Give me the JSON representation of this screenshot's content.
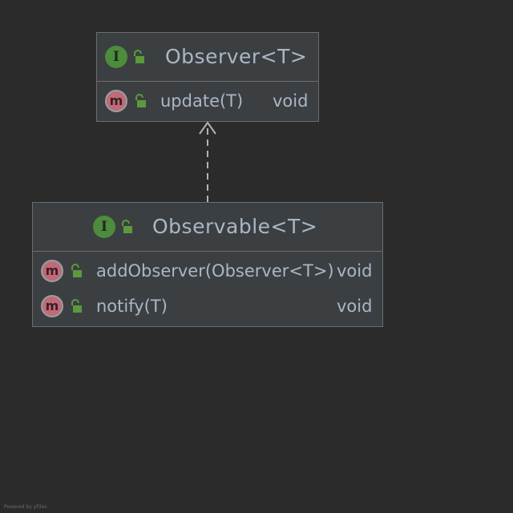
{
  "diagram": {
    "classes": [
      {
        "id": "observer",
        "title": "Observer<T>",
        "kind_letter": "I",
        "kind": "interface",
        "members": [
          {
            "name": "update(T)",
            "type": "void"
          }
        ]
      },
      {
        "id": "observable",
        "title": "Observable<T>",
        "kind_letter": "I",
        "kind": "interface",
        "members": [
          {
            "name": "addObserver(Observer<T>)",
            "type": "void"
          },
          {
            "name": "notify(T)",
            "type": "void"
          }
        ]
      }
    ],
    "edges": [
      {
        "from": "observable",
        "to": "observer",
        "style": "dashed",
        "arrowhead": "open"
      }
    ],
    "method_icon_letter": "m",
    "footer_text": "Powered by yFiles"
  },
  "colors": {
    "background": "#2b2b2b",
    "box_fill": "#3c3f41",
    "box_border": "#6b6e70",
    "text": "#a9b7c6",
    "interface_icon": "#4d8b3d",
    "method_icon": "#c06a79",
    "lock_icon": "#5a9a3c",
    "edge": "#b0b3b5"
  }
}
